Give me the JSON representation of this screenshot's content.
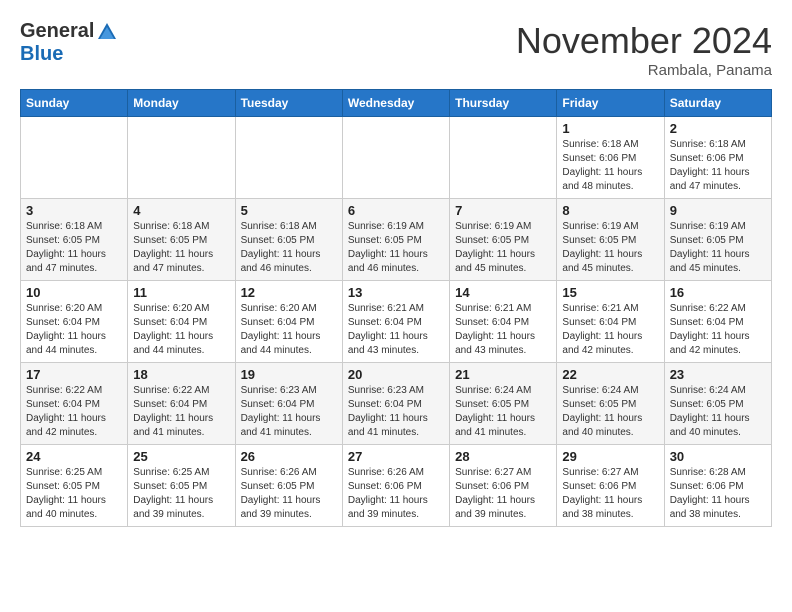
{
  "header": {
    "logo_general": "General",
    "logo_blue": "Blue",
    "month_title": "November 2024",
    "location": "Rambala, Panama"
  },
  "weekdays": [
    "Sunday",
    "Monday",
    "Tuesday",
    "Wednesday",
    "Thursday",
    "Friday",
    "Saturday"
  ],
  "weeks": [
    [
      {
        "day": "",
        "sunrise": "",
        "sunset": "",
        "daylight": ""
      },
      {
        "day": "",
        "sunrise": "",
        "sunset": "",
        "daylight": ""
      },
      {
        "day": "",
        "sunrise": "",
        "sunset": "",
        "daylight": ""
      },
      {
        "day": "",
        "sunrise": "",
        "sunset": "",
        "daylight": ""
      },
      {
        "day": "",
        "sunrise": "",
        "sunset": "",
        "daylight": ""
      },
      {
        "day": "1",
        "sunrise": "Sunrise: 6:18 AM",
        "sunset": "Sunset: 6:06 PM",
        "daylight": "Daylight: 11 hours and 48 minutes."
      },
      {
        "day": "2",
        "sunrise": "Sunrise: 6:18 AM",
        "sunset": "Sunset: 6:06 PM",
        "daylight": "Daylight: 11 hours and 47 minutes."
      }
    ],
    [
      {
        "day": "3",
        "sunrise": "Sunrise: 6:18 AM",
        "sunset": "Sunset: 6:05 PM",
        "daylight": "Daylight: 11 hours and 47 minutes."
      },
      {
        "day": "4",
        "sunrise": "Sunrise: 6:18 AM",
        "sunset": "Sunset: 6:05 PM",
        "daylight": "Daylight: 11 hours and 47 minutes."
      },
      {
        "day": "5",
        "sunrise": "Sunrise: 6:18 AM",
        "sunset": "Sunset: 6:05 PM",
        "daylight": "Daylight: 11 hours and 46 minutes."
      },
      {
        "day": "6",
        "sunrise": "Sunrise: 6:19 AM",
        "sunset": "Sunset: 6:05 PM",
        "daylight": "Daylight: 11 hours and 46 minutes."
      },
      {
        "day": "7",
        "sunrise": "Sunrise: 6:19 AM",
        "sunset": "Sunset: 6:05 PM",
        "daylight": "Daylight: 11 hours and 45 minutes."
      },
      {
        "day": "8",
        "sunrise": "Sunrise: 6:19 AM",
        "sunset": "Sunset: 6:05 PM",
        "daylight": "Daylight: 11 hours and 45 minutes."
      },
      {
        "day": "9",
        "sunrise": "Sunrise: 6:19 AM",
        "sunset": "Sunset: 6:05 PM",
        "daylight": "Daylight: 11 hours and 45 minutes."
      }
    ],
    [
      {
        "day": "10",
        "sunrise": "Sunrise: 6:20 AM",
        "sunset": "Sunset: 6:04 PM",
        "daylight": "Daylight: 11 hours and 44 minutes."
      },
      {
        "day": "11",
        "sunrise": "Sunrise: 6:20 AM",
        "sunset": "Sunset: 6:04 PM",
        "daylight": "Daylight: 11 hours and 44 minutes."
      },
      {
        "day": "12",
        "sunrise": "Sunrise: 6:20 AM",
        "sunset": "Sunset: 6:04 PM",
        "daylight": "Daylight: 11 hours and 44 minutes."
      },
      {
        "day": "13",
        "sunrise": "Sunrise: 6:21 AM",
        "sunset": "Sunset: 6:04 PM",
        "daylight": "Daylight: 11 hours and 43 minutes."
      },
      {
        "day": "14",
        "sunrise": "Sunrise: 6:21 AM",
        "sunset": "Sunset: 6:04 PM",
        "daylight": "Daylight: 11 hours and 43 minutes."
      },
      {
        "day": "15",
        "sunrise": "Sunrise: 6:21 AM",
        "sunset": "Sunset: 6:04 PM",
        "daylight": "Daylight: 11 hours and 42 minutes."
      },
      {
        "day": "16",
        "sunrise": "Sunrise: 6:22 AM",
        "sunset": "Sunset: 6:04 PM",
        "daylight": "Daylight: 11 hours and 42 minutes."
      }
    ],
    [
      {
        "day": "17",
        "sunrise": "Sunrise: 6:22 AM",
        "sunset": "Sunset: 6:04 PM",
        "daylight": "Daylight: 11 hours and 42 minutes."
      },
      {
        "day": "18",
        "sunrise": "Sunrise: 6:22 AM",
        "sunset": "Sunset: 6:04 PM",
        "daylight": "Daylight: 11 hours and 41 minutes."
      },
      {
        "day": "19",
        "sunrise": "Sunrise: 6:23 AM",
        "sunset": "Sunset: 6:04 PM",
        "daylight": "Daylight: 11 hours and 41 minutes."
      },
      {
        "day": "20",
        "sunrise": "Sunrise: 6:23 AM",
        "sunset": "Sunset: 6:04 PM",
        "daylight": "Daylight: 11 hours and 41 minutes."
      },
      {
        "day": "21",
        "sunrise": "Sunrise: 6:24 AM",
        "sunset": "Sunset: 6:05 PM",
        "daylight": "Daylight: 11 hours and 41 minutes."
      },
      {
        "day": "22",
        "sunrise": "Sunrise: 6:24 AM",
        "sunset": "Sunset: 6:05 PM",
        "daylight": "Daylight: 11 hours and 40 minutes."
      },
      {
        "day": "23",
        "sunrise": "Sunrise: 6:24 AM",
        "sunset": "Sunset: 6:05 PM",
        "daylight": "Daylight: 11 hours and 40 minutes."
      }
    ],
    [
      {
        "day": "24",
        "sunrise": "Sunrise: 6:25 AM",
        "sunset": "Sunset: 6:05 PM",
        "daylight": "Daylight: 11 hours and 40 minutes."
      },
      {
        "day": "25",
        "sunrise": "Sunrise: 6:25 AM",
        "sunset": "Sunset: 6:05 PM",
        "daylight": "Daylight: 11 hours and 39 minutes."
      },
      {
        "day": "26",
        "sunrise": "Sunrise: 6:26 AM",
        "sunset": "Sunset: 6:05 PM",
        "daylight": "Daylight: 11 hours and 39 minutes."
      },
      {
        "day": "27",
        "sunrise": "Sunrise: 6:26 AM",
        "sunset": "Sunset: 6:06 PM",
        "daylight": "Daylight: 11 hours and 39 minutes."
      },
      {
        "day": "28",
        "sunrise": "Sunrise: 6:27 AM",
        "sunset": "Sunset: 6:06 PM",
        "daylight": "Daylight: 11 hours and 39 minutes."
      },
      {
        "day": "29",
        "sunrise": "Sunrise: 6:27 AM",
        "sunset": "Sunset: 6:06 PM",
        "daylight": "Daylight: 11 hours and 38 minutes."
      },
      {
        "day": "30",
        "sunrise": "Sunrise: 6:28 AM",
        "sunset": "Sunset: 6:06 PM",
        "daylight": "Daylight: 11 hours and 38 minutes."
      }
    ]
  ]
}
